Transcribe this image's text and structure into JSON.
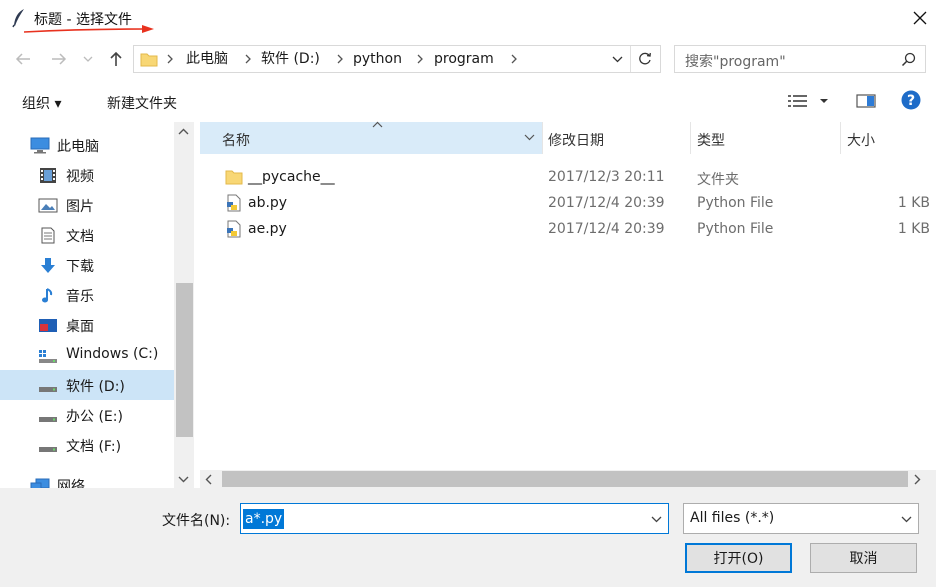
{
  "window": {
    "title": "标题 - 选择文件",
    "icon": "feather-icon",
    "close_icon": "close-icon",
    "annotation_color": "#e8321f"
  },
  "nav": {
    "back_icon": "back-arrow-icon",
    "forward_icon": "forward-arrow-icon",
    "recent_icon": "chevron-down-icon",
    "up_icon": "up-arrow-icon",
    "breadcrumb": [
      "此电脑",
      "软件 (D:)",
      "python",
      "program"
    ],
    "refresh_icon": "refresh-icon",
    "search_placeholder": "搜索\"program\"",
    "search_icon": "search-icon"
  },
  "toolbar": {
    "organize_label": "组织 ▾",
    "new_folder_label": "新建文件夹",
    "view_icon": "view-options-icon",
    "preview_icon": "preview-pane-icon",
    "help_icon": "help-icon"
  },
  "sidebar": {
    "items": [
      {
        "label": "此电脑",
        "icon": "computer-icon",
        "selected": false
      },
      {
        "label": "视频",
        "icon": "video-icon",
        "selected": false
      },
      {
        "label": "图片",
        "icon": "pictures-icon",
        "selected": false
      },
      {
        "label": "文档",
        "icon": "documents-icon",
        "selected": false
      },
      {
        "label": "下载",
        "icon": "download-icon",
        "selected": false
      },
      {
        "label": "音乐",
        "icon": "music-icon",
        "selected": false
      },
      {
        "label": "桌面",
        "icon": "desktop-icon",
        "selected": false
      },
      {
        "label": "Windows (C:)",
        "icon": "drive-icon",
        "selected": false
      },
      {
        "label": "软件 (D:)",
        "icon": "drive-icon",
        "selected": true
      },
      {
        "label": "办公 (E:)",
        "icon": "drive-icon",
        "selected": false
      },
      {
        "label": "文档 (F:)",
        "icon": "drive-icon",
        "selected": false
      },
      {
        "label": "网络",
        "icon": "network-icon",
        "selected": false
      }
    ]
  },
  "columns": {
    "name": "名称",
    "modified": "修改日期",
    "type": "类型",
    "size": "大小"
  },
  "files": [
    {
      "name": "__pycache__",
      "modified": "2017/12/3 20:11",
      "type": "文件夹",
      "size": "",
      "icon": "folder-icon"
    },
    {
      "name": "ab.py",
      "modified": "2017/12/4 20:39",
      "type": "Python File",
      "size": "1 KB",
      "icon": "python-file-icon"
    },
    {
      "name": "ae.py",
      "modified": "2017/12/4 20:39",
      "type": "Python File",
      "size": "1 KB",
      "icon": "python-file-icon"
    }
  ],
  "footer": {
    "filename_label": "文件名(N):",
    "filename_value": "a*.py",
    "filetype_value": "All files (*.*)",
    "open_label": "打开(O)",
    "cancel_label": "取消"
  },
  "colors": {
    "accent": "#0078d7",
    "selection": "#cce4f7",
    "header_highlight": "#d9ebf9"
  }
}
